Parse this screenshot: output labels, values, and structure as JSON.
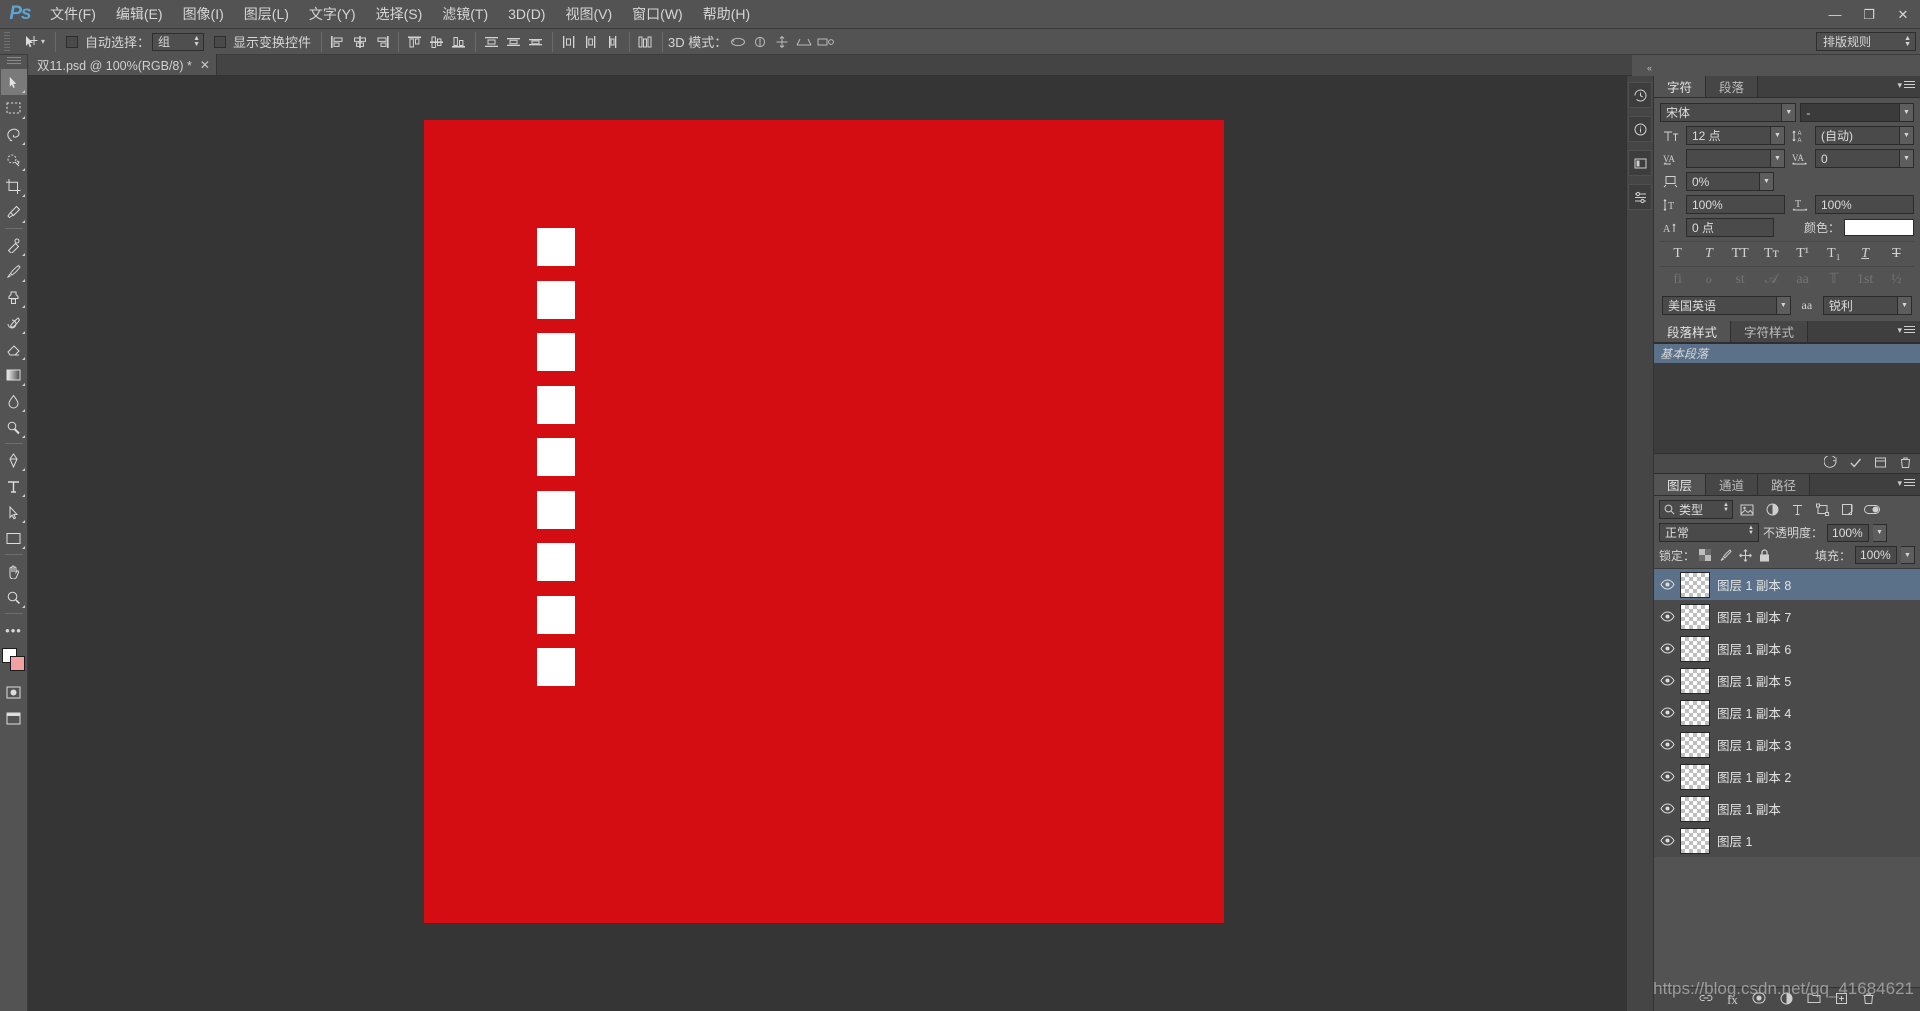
{
  "app": {
    "logo": "Ps",
    "menus": [
      {
        "label": "文件(F)"
      },
      {
        "label": "编辑(E)"
      },
      {
        "label": "图像(I)"
      },
      {
        "label": "图层(L)"
      },
      {
        "label": "文字(Y)"
      },
      {
        "label": "选择(S)"
      },
      {
        "label": "滤镜(T)"
      },
      {
        "label": "3D(D)"
      },
      {
        "label": "视图(V)"
      },
      {
        "label": "窗口(W)"
      },
      {
        "label": "帮助(H)"
      }
    ],
    "window_controls": {
      "minimize": "—",
      "maximize": "❐",
      "close": "✕"
    }
  },
  "options_bar": {
    "auto_select_label": "自动选择：",
    "auto_select_value": "组",
    "show_transform_label": "显示变换控件",
    "mode_3d_label": "3D 模式：",
    "workspace": "排版规则"
  },
  "document": {
    "tab_title": "双11.psd @ 100%(RGB/8) *",
    "close_glyph": "✕",
    "canvas_bg": "#d40d12",
    "square_color": "#ffffff",
    "squares_count": 9
  },
  "character_panel": {
    "tabs": [
      {
        "label": "字符",
        "active": true
      },
      {
        "label": "段落",
        "active": false
      }
    ],
    "font_family": "宋体",
    "font_style": "-",
    "font_size": "12 点",
    "leading": "(自动)",
    "kerning": "",
    "tracking": "0",
    "vertical_scale_tsume": "0%",
    "vertical_scale": "100%",
    "horizontal_scale": "100%",
    "baseline_shift": "0 点",
    "color_label": "颜色：",
    "color_value": "#ffffff",
    "style_buttons": [
      "T",
      "T",
      "TT",
      "Tᴛ",
      "T¹",
      "T₁",
      "T",
      "T"
    ],
    "ot_buttons": [
      "fi",
      "ℴ",
      "st",
      "𝒜",
      "aa",
      "𝕋",
      "1st",
      "½"
    ],
    "language": "美国英语",
    "aa_icon_label": "aa",
    "antialias": "锐利"
  },
  "styles_panel": {
    "tabs": [
      {
        "label": "段落样式",
        "active": true
      },
      {
        "label": "字符样式",
        "active": false
      }
    ],
    "items": [
      {
        "label": "基本段落",
        "selected": true
      }
    ]
  },
  "layers_panel": {
    "tabs": [
      {
        "label": "图层",
        "active": true
      },
      {
        "label": "通道",
        "active": false
      },
      {
        "label": "路径",
        "active": false
      }
    ],
    "filter_type": "类型",
    "blend_mode": "正常",
    "opacity_label": "不透明度：",
    "opacity_value": "100%",
    "lock_label": "锁定：",
    "fill_label": "填充：",
    "fill_value": "100%",
    "layers": [
      {
        "name": "图层 1 副本 8",
        "visible": true,
        "selected": true
      },
      {
        "name": "图层 1 副本 7",
        "visible": true,
        "selected": false
      },
      {
        "name": "图层 1 副本 6",
        "visible": true,
        "selected": false
      },
      {
        "name": "图层 1 副本 5",
        "visible": true,
        "selected": false
      },
      {
        "name": "图层 1 副本 4",
        "visible": true,
        "selected": false
      },
      {
        "name": "图层 1 副本 3",
        "visible": true,
        "selected": false
      },
      {
        "name": "图层 1 副本 2",
        "visible": true,
        "selected": false
      },
      {
        "name": "图层 1 副本",
        "visible": true,
        "selected": false
      },
      {
        "name": "图层 1",
        "visible": true,
        "selected": false
      }
    ]
  },
  "watermark": {
    "text": "https://blog.csdn.net/qq_41684621"
  },
  "colors": {
    "accent_red": "#d40d12",
    "selection_blue": "#5b7089",
    "panel_bg": "#535353",
    "canvas_bg": "#353535",
    "logo_blue": "#5ba4d4"
  }
}
